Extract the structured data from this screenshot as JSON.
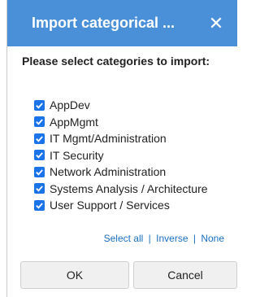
{
  "dialog": {
    "title": "Import categorical ...",
    "close_glyph": "✕",
    "prompt": "Please select categories to import:",
    "categories": [
      {
        "label": "AppDev",
        "checked": true
      },
      {
        "label": "AppMgmt",
        "checked": true
      },
      {
        "label": "IT Mgmt/Administration",
        "checked": true
      },
      {
        "label": "IT Security",
        "checked": true
      },
      {
        "label": "Network Administration",
        "checked": true
      },
      {
        "label": "Systems Analysis / Architecture",
        "checked": true
      },
      {
        "label": "User Support / Services",
        "checked": true
      }
    ],
    "links": {
      "select_all": "Select all",
      "inverse": "Inverse",
      "none": "None",
      "separator": "|"
    },
    "ok_label": "OK",
    "cancel_label": "Cancel"
  },
  "colors": {
    "titlebar": "#4a90d9",
    "checkbox": "#1a73e8",
    "link": "#1a6fc0"
  }
}
